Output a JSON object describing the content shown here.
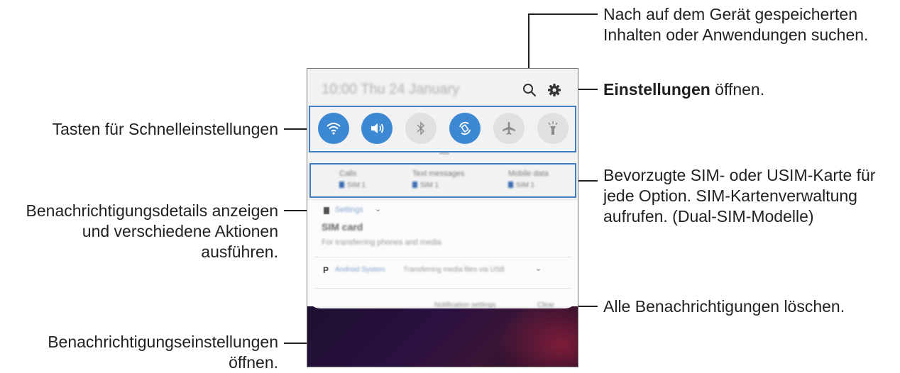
{
  "callouts": {
    "search": "Nach auf dem Gerät gespeicherten\nInhalten oder Anwendungen suchen.",
    "settings_bold": "Einstellungen",
    "settings_rest": " öffnen.",
    "quick_settings": "Tasten für Schnelleinstellungen",
    "sim": "Bevorzugte SIM- oder USIM-Karte für\njede Option. SIM-Kartenverwaltung\naufrufen. (Dual-SIM-Modelle)",
    "notif_details": "Benachrichtigungsdetails anzeigen\nund verschiedene Aktionen\nausführen.",
    "clear_all": "Alle Benachrichtigungen löschen.",
    "notif_settings": "Benachrichtigungseinstellungen\nöffnen."
  },
  "phone": {
    "status_time": "10:00  Thu 24 January",
    "quick_settings": [
      {
        "icon": "wifi-icon",
        "active": true
      },
      {
        "icon": "sound-icon",
        "active": true
      },
      {
        "icon": "bluetooth-icon",
        "active": false
      },
      {
        "icon": "auto-rotate-icon",
        "active": true
      },
      {
        "icon": "airplane-icon",
        "active": false
      },
      {
        "icon": "flashlight-icon",
        "active": false
      }
    ],
    "sim": [
      {
        "title": "Calls",
        "value": "SIM 1"
      },
      {
        "title": "Text messages",
        "value": "SIM 1"
      },
      {
        "title": "Mobile data",
        "value": "SIM 1"
      }
    ],
    "notification": {
      "app": "Settings",
      "title": "SIM card",
      "body": "For transferring phones and media"
    },
    "system_notification": {
      "app": "Android System",
      "text": "Transferring media files via USB"
    },
    "footer": {
      "notification_settings": "Notification settings",
      "clear": "Clear"
    }
  },
  "colors": {
    "accent_blue": "#3d88d3",
    "frame_blue": "#3f7ec6",
    "text": "#231f20"
  }
}
